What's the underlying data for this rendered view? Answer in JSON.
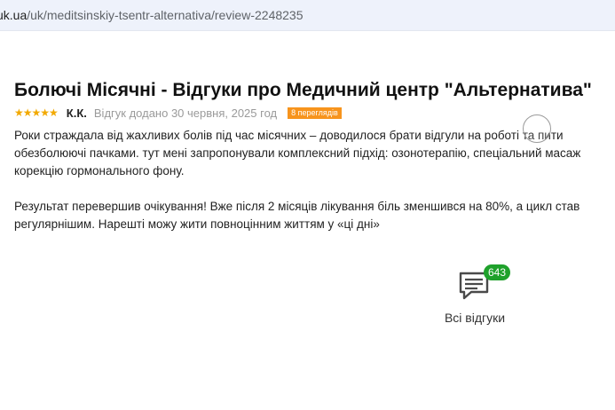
{
  "browser": {
    "url_host": "uk.ua",
    "url_path": "/uk/meditsinskiy-tsentr-alternativa/review-2248235"
  },
  "review": {
    "title": "Болючі Місячні - Відгуки про Медичний центр \"Альтернатива\"",
    "rating": 5,
    "stars": "★★★★★",
    "author": "К.К.",
    "date": "Відгук додано 30 червня, 2025 год",
    "views": "8 переглядів",
    "paragraphs": [
      [
        "Роки страждала від жахливих болів під час місячних – доводилося брати відгули на роботі та пити",
        "обезболюючі пачками. тут мені запропонували комплексний підхід: озонотерапію, спеціальний масаж",
        "корекцію гормонального фону."
      ],
      [
        "Результат перевершив очікування! Вже після 2 місяців лікування біль зменшився на 80%, а цикл став",
        "регулярнішим. Нарешті можу жити повноцінним життям у «ці дні»"
      ]
    ]
  },
  "all_reviews": {
    "count": "643",
    "label": "Всі відгуки",
    "icon": "comment-icon",
    "badge_color": "#1fa12b"
  },
  "colors": {
    "stars": "#f2a900",
    "views_badge": "#f7941d"
  }
}
